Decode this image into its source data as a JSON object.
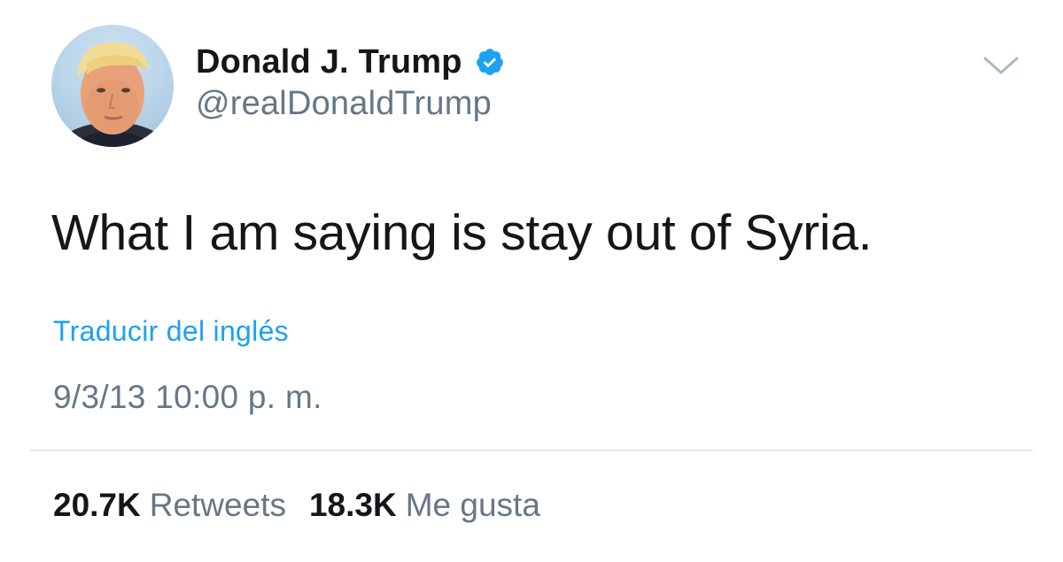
{
  "tweet": {
    "author": {
      "display_name": "Donald J. Trump",
      "handle": "@realDonaldTrump",
      "verified": true
    },
    "text": "What I am saying is stay out of Syria.",
    "translate_label": "Traducir del inglés",
    "timestamp": "9/3/13 10:00 p. m.",
    "stats": {
      "retweets": {
        "count": "20.7K",
        "label": "Retweets"
      },
      "likes": {
        "count": "18.3K",
        "label": "Me gusta"
      }
    }
  },
  "icons": {
    "verified": "verified-badge-icon",
    "caret": "chevron-down-icon"
  },
  "colors": {
    "text_primary": "#14171a",
    "text_secondary": "#657786",
    "link": "#1da1f2",
    "verified": "#1da1f2",
    "divider": "#e1e8ed",
    "background": "#ffffff"
  }
}
